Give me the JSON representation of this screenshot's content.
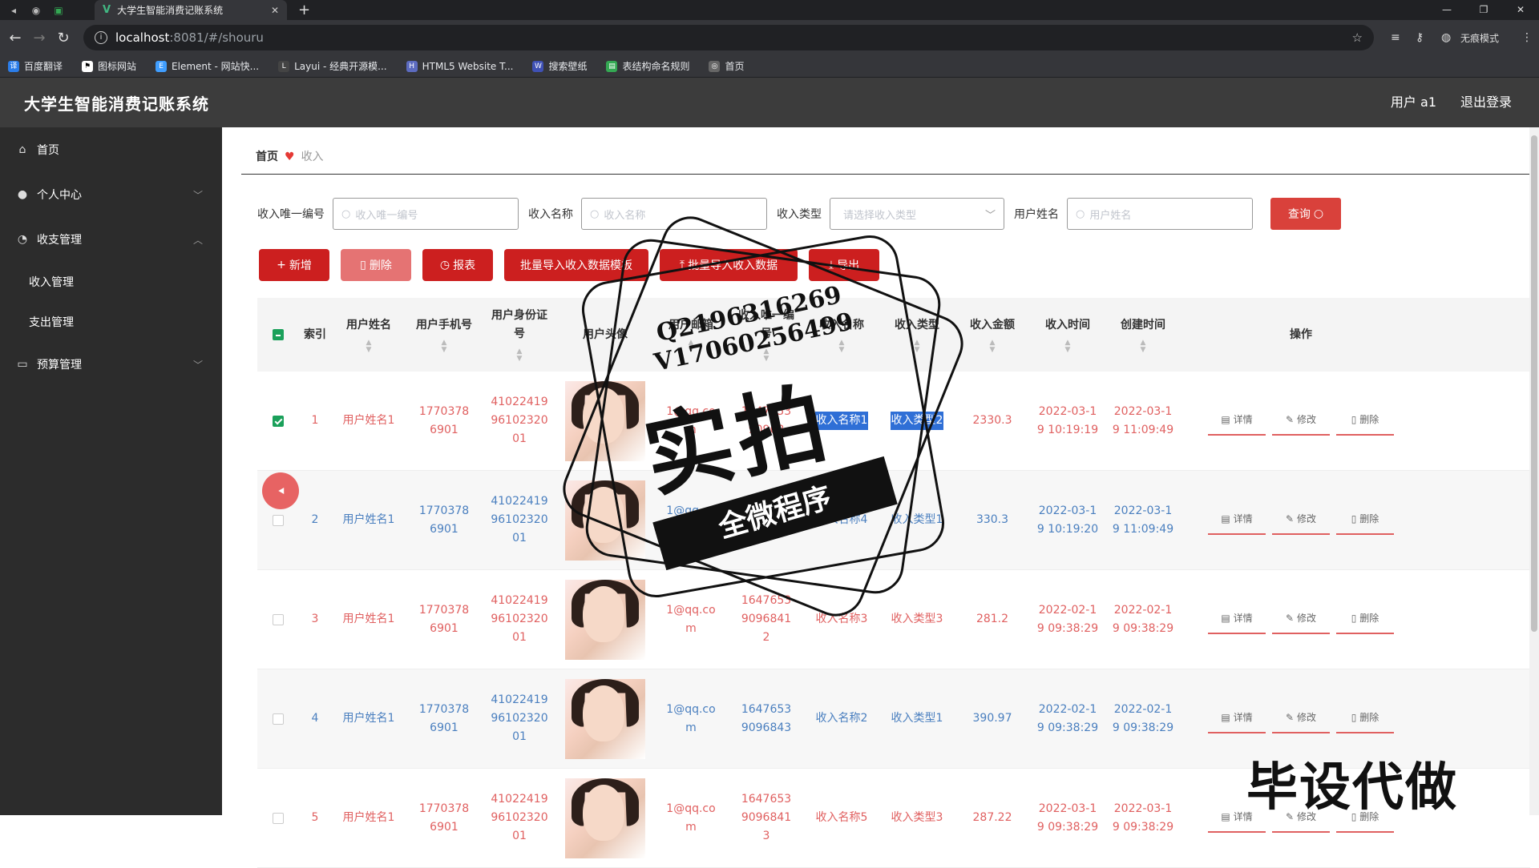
{
  "browser": {
    "tab_title": "大学生智能消费记账系统",
    "url_host": "localhost",
    "url_path": ":8081/#/shouru",
    "incognito_label": "无痕模式",
    "bookmarks": [
      "百度翻译",
      "图标网站",
      "Element - 网站快...",
      "Layui - 经典开源模...",
      "HTML5 Website T...",
      "搜索壁纸",
      "表结构命名规则",
      "首页"
    ]
  },
  "header": {
    "title": "大学生智能消费记账系统",
    "user": "用户 a1",
    "logout": "退出登录"
  },
  "sidebar": {
    "items": [
      {
        "label": "首页",
        "icon": "home-icon"
      },
      {
        "label": "个人中心",
        "icon": "user-icon"
      },
      {
        "label": "收支管理",
        "icon": "dashboard-icon"
      },
      {
        "label": "收入管理"
      },
      {
        "label": "支出管理"
      },
      {
        "label": "预算管理",
        "icon": "chat-icon"
      }
    ]
  },
  "breadcrumb": {
    "home": "首页",
    "current": "收入"
  },
  "search": {
    "f1_label": "收入唯一编号",
    "f1_placeholder": "收入唯一编号",
    "f2_label": "收入名称",
    "f2_placeholder": "收入名称",
    "f3_label": "收入类型",
    "f3_placeholder": "请选择收入类型",
    "f4_label": "用户姓名",
    "f4_placeholder": "用户姓名",
    "query": "查询"
  },
  "toolbar": {
    "add": "新增",
    "delete": "删除",
    "report": "报表",
    "import_tpl": "批量导入收入数据模板",
    "import": "批量导入收入数据",
    "export": "导出"
  },
  "table": {
    "headers": {
      "index": "索引",
      "name": "用户姓名",
      "phone": "用户手机号",
      "idcard": "用户身份证号",
      "avatar": "用户头像",
      "email": "用户邮箱",
      "no": "收入唯一编号",
      "iname": "收入名称",
      "itype": "收入类型",
      "amount": "收入金额",
      "itime": "收入时间",
      "ctime": "创建时间",
      "ops": "操作"
    },
    "ops": {
      "detail": "详情",
      "edit": "修改",
      "delete": "删除"
    },
    "rows": [
      {
        "index": "1",
        "name": "用户姓名1",
        "phone": "17703786901",
        "idcard": "410224199610232001",
        "email": "1@qq.com",
        "no": "164765390968",
        "iname": "收入名称1",
        "itype": "收入类型2",
        "amount": "2330.3",
        "itime": "2022-03-19 10:19:19",
        "ctime": "2022-03-19 11:09:49"
      },
      {
        "index": "2",
        "name": "用户姓名1",
        "phone": "17703786901",
        "idcard": "410224199610232001",
        "email": "1@qq.com",
        "no": "164765390968",
        "iname": "收入名称4",
        "itype": "收入类型1",
        "amount": "330.3",
        "itime": "2022-03-19 10:19:20",
        "ctime": "2022-03-19 11:09:49"
      },
      {
        "index": "3",
        "name": "用户姓名1",
        "phone": "17703786901",
        "idcard": "410224199610232001",
        "email": "1@qq.com",
        "no": "164765390968412",
        "iname": "收入名称3",
        "itype": "收入类型3",
        "amount": "281.2",
        "itime": "2022-02-19 09:38:29",
        "ctime": "2022-02-19 09:38:29"
      },
      {
        "index": "4",
        "name": "用户姓名1",
        "phone": "17703786901",
        "idcard": "410224199610232001",
        "email": "1@qq.com",
        "no": "16476539096843",
        "iname": "收入名称2",
        "itype": "收入类型1",
        "amount": "390.97",
        "itime": "2022-02-19 09:38:29",
        "ctime": "2022-02-19 09:38:29"
      },
      {
        "index": "5",
        "name": "用户姓名1",
        "phone": "17703786901",
        "idcard": "410224199610232001",
        "email": "1@qq.com",
        "no": "164765390968413",
        "iname": "收入名称5",
        "itype": "收入类型3",
        "amount": "287.22",
        "itime": "2022-03-19 09:38:29",
        "ctime": "2022-03-19 09:38:29"
      }
    ]
  },
  "overlay": {
    "qq": "Q2196316269",
    "v": "V17060256499",
    "stamp": "实拍",
    "banner": "全微程序",
    "watermark": "毕设代做"
  }
}
